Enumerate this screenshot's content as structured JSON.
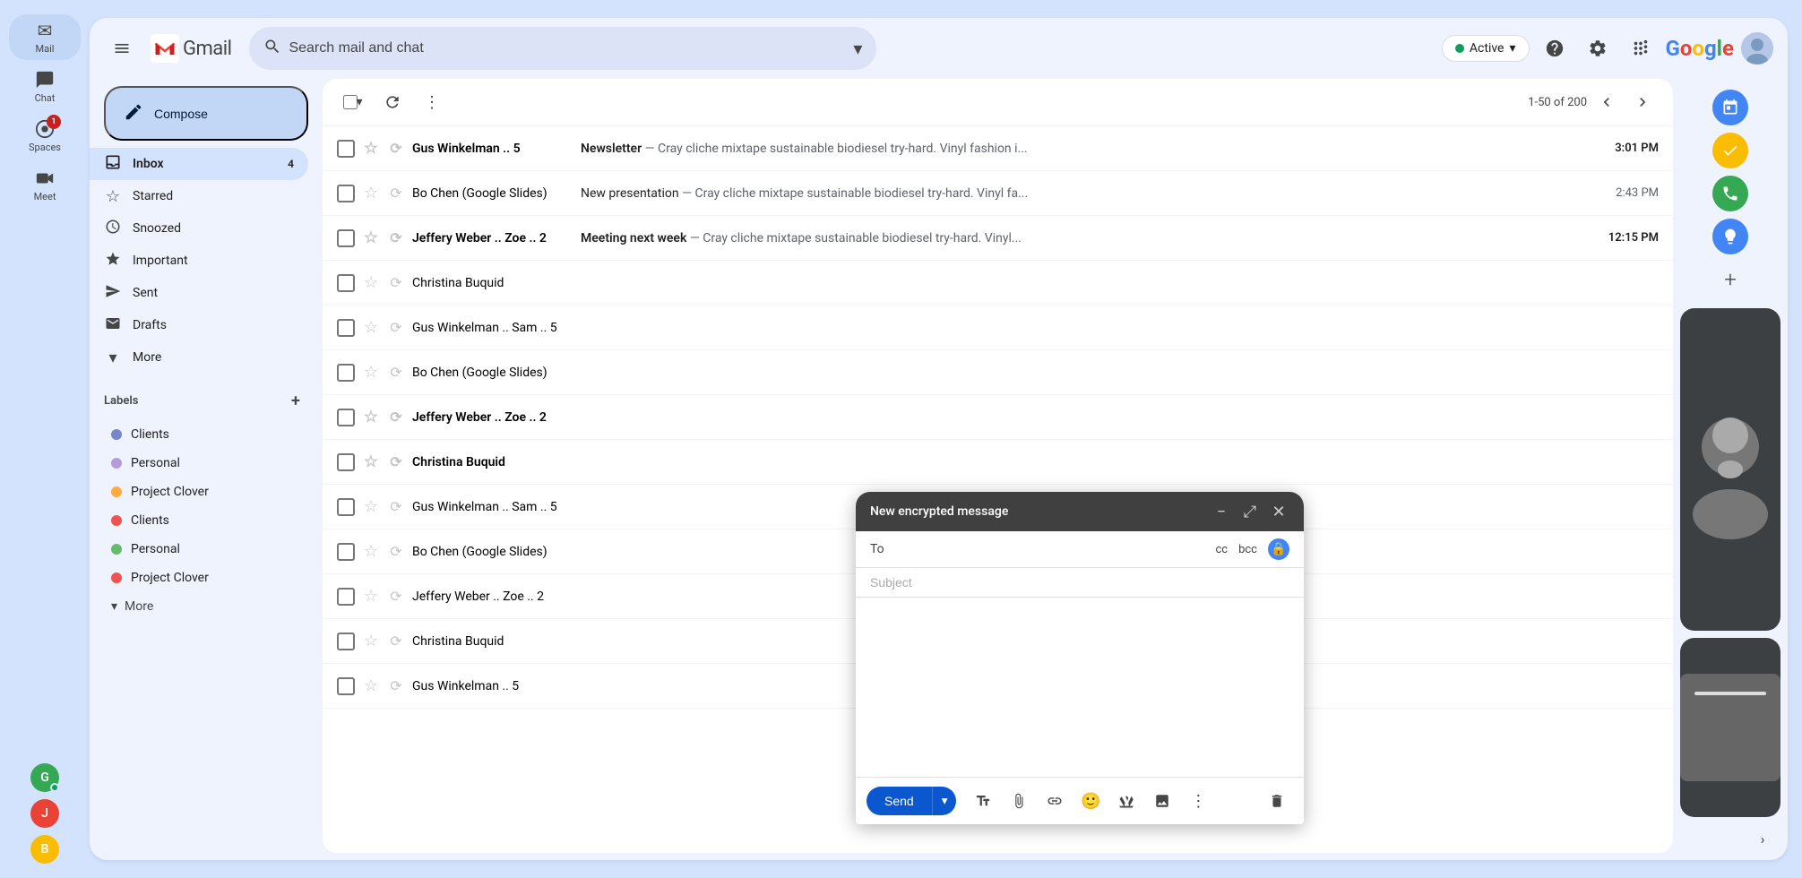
{
  "app": {
    "title": "Gmail",
    "logo_m": "M"
  },
  "topbar": {
    "search_placeholder": "Search mail and chat",
    "active_status": "Active",
    "active_dropdown": "▾"
  },
  "compose_btn": {
    "label": "Compose",
    "icon": "✏️"
  },
  "nav": {
    "items": [
      {
        "id": "inbox",
        "label": "Inbox",
        "icon": "📥",
        "badge": "4",
        "active": true
      },
      {
        "id": "starred",
        "label": "Starred",
        "icon": "☆",
        "badge": ""
      },
      {
        "id": "snoozed",
        "label": "Snoozed",
        "icon": "🕐",
        "badge": ""
      },
      {
        "id": "important",
        "label": "Important",
        "icon": "🏷",
        "badge": ""
      },
      {
        "id": "sent",
        "label": "Sent",
        "icon": "📤",
        "badge": ""
      },
      {
        "id": "drafts",
        "label": "Drafts",
        "icon": "📋",
        "badge": ""
      },
      {
        "id": "more",
        "label": "More",
        "icon": "▾",
        "badge": ""
      }
    ],
    "labels_title": "Labels",
    "labels": [
      {
        "id": "clients1",
        "label": "Clients",
        "color": "#7986cb"
      },
      {
        "id": "personal1",
        "label": "Personal",
        "color": "#b39ddb"
      },
      {
        "id": "projectclover1",
        "label": "Project Clover",
        "color": "#ffab40"
      },
      {
        "id": "clients2",
        "label": "Clients",
        "color": "#ef5350"
      },
      {
        "id": "personal2",
        "label": "Personal",
        "color": "#66bb6a"
      },
      {
        "id": "projectclover2",
        "label": "Project Clover",
        "color": "#ef5350"
      }
    ],
    "more_labels": "More"
  },
  "toolbar": {
    "pagination": "1-50 of 200"
  },
  "emails": [
    {
      "id": 1,
      "sender": "Gus Winkelman .. 5",
      "subject": "Newsletter",
      "preview": "— Cray cliche mixtape sustainable biodiesel try-hard. Vinyl fashion i...",
      "time": "3:01 PM",
      "unread": true
    },
    {
      "id": 2,
      "sender": "Bo Chen (Google Slides)",
      "subject": "New presentation",
      "preview": "— Cray cliche mixtape sustainable biodiesel try-hard. Vinyl fa...",
      "time": "2:43 PM",
      "unread": false
    },
    {
      "id": 3,
      "sender": "Jeffery Weber .. Zoe .. 2",
      "subject": "Meeting next week",
      "preview": "— Cray cliche mixtape sustainable biodiesel try-hard. Vinyl...",
      "time": "12:15 PM",
      "unread": true
    },
    {
      "id": 4,
      "sender": "Christina Buquid",
      "subject": "",
      "preview": "",
      "time": "",
      "unread": false
    },
    {
      "id": 5,
      "sender": "Gus Winkelman .. Sam .. 5",
      "subject": "",
      "preview": "",
      "time": "",
      "unread": false
    },
    {
      "id": 6,
      "sender": "Bo Chen (Google Slides)",
      "subject": "",
      "preview": "",
      "time": "",
      "unread": false
    },
    {
      "id": 7,
      "sender": "Jeffery Weber .. Zoe .. 2",
      "subject": "",
      "preview": "",
      "time": "",
      "unread": true
    },
    {
      "id": 8,
      "sender": "Christina Buquid",
      "subject": "",
      "preview": "",
      "time": "",
      "unread": true
    },
    {
      "id": 9,
      "sender": "Gus Winkelman .. Sam .. 5",
      "subject": "",
      "preview": "",
      "time": "",
      "unread": false
    },
    {
      "id": 10,
      "sender": "Bo Chen (Google Slides)",
      "subject": "",
      "preview": "",
      "time": "",
      "unread": false
    },
    {
      "id": 11,
      "sender": "Jeffery Weber .. Zoe .. 2",
      "subject": "",
      "preview": "",
      "time": "",
      "unread": false
    },
    {
      "id": 12,
      "sender": "Christina Buquid",
      "subject": "",
      "preview": "",
      "time": "",
      "unread": false
    },
    {
      "id": 13,
      "sender": "Gus Winkelman .. 5",
      "subject": "",
      "preview": "",
      "time": "",
      "unread": false
    }
  ],
  "compose": {
    "title": "New encrypted message",
    "to_label": "To",
    "to_value": "",
    "cc_label": "cc",
    "bcc_label": "bcc",
    "subject_label": "Subject",
    "subject_value": "",
    "body": "",
    "send_label": "Send"
  },
  "right_panel": {
    "icons": [
      {
        "id": "calendar",
        "icon": "⊞",
        "color": "#4285f4"
      },
      {
        "id": "tasks",
        "icon": "✓",
        "color": "#fbbc04"
      },
      {
        "id": "contacts",
        "icon": "✆",
        "color": "#34a853"
      },
      {
        "id": "keep",
        "icon": "★",
        "color": "#4285f4"
      },
      {
        "id": "add",
        "icon": "+",
        "color": ""
      }
    ]
  },
  "icon_sidebar": {
    "items": [
      {
        "id": "mail",
        "icon": "✉",
        "label": "Mail",
        "active": true,
        "badge": ""
      },
      {
        "id": "chat",
        "icon": "💬",
        "label": "Chat",
        "active": false,
        "badge": ""
      },
      {
        "id": "spaces",
        "icon": "⊕",
        "label": "Spaces",
        "active": false,
        "badge": ""
      },
      {
        "id": "meet",
        "icon": "📹",
        "label": "Meet",
        "active": false,
        "badge": ""
      }
    ],
    "avatars": [
      {
        "id": "avatar1",
        "initial": "G",
        "color": "#34a853",
        "online": true
      },
      {
        "id": "avatar2",
        "initial": "J",
        "color": "#ea4335",
        "online": false
      },
      {
        "id": "avatar3",
        "initial": "B",
        "color": "#fbbc04",
        "online": false
      }
    ]
  }
}
